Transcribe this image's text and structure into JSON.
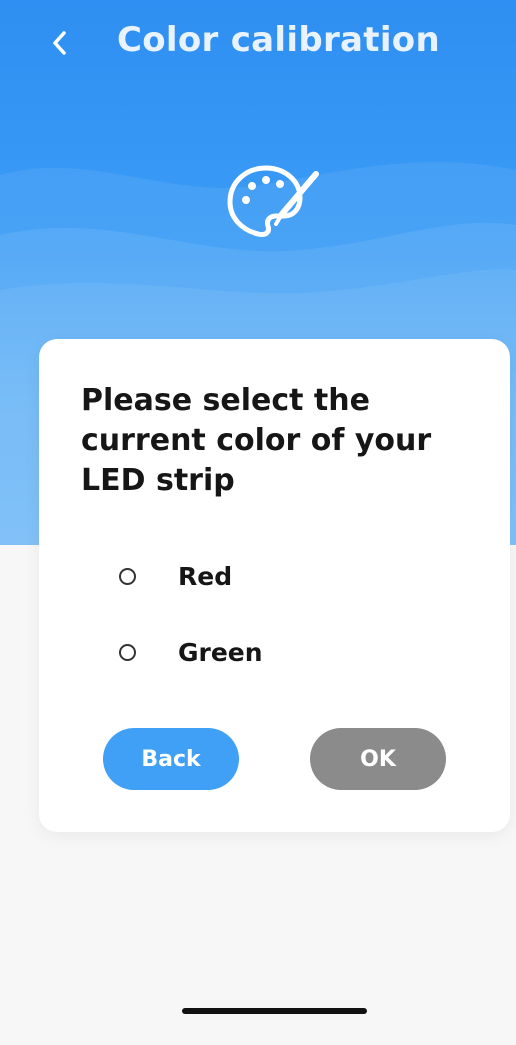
{
  "header": {
    "title": "Color calibration",
    "back_icon": "chevron-left-icon"
  },
  "hero": {
    "icon": "palette-icon",
    "color_top": "#2f8ff2",
    "color_bottom": "#63b3f8"
  },
  "dialog": {
    "question": "Please select the current color of your LED strip",
    "options": [
      {
        "label": "Red",
        "selected": false
      },
      {
        "label": "Green",
        "selected": false
      }
    ],
    "back_label": "Back",
    "ok_label": "OK",
    "back_color": "#3fa0f6",
    "ok_color": "#8b8b8b"
  }
}
